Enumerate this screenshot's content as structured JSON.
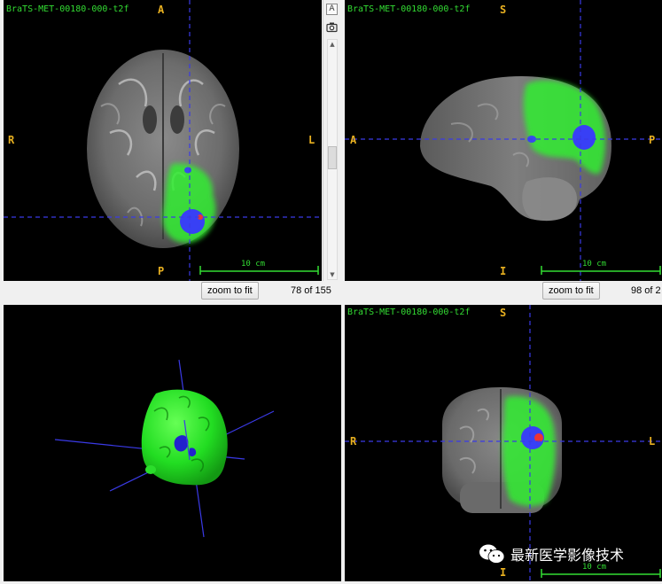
{
  "dataset": "BraTS-MET-00180-000-t2f",
  "scale_bar": "10 cm",
  "zoom_label": "zoom to fit",
  "axial": {
    "orientation": {
      "top": "A",
      "bottom": "P",
      "left": "R",
      "right": "L"
    },
    "slice_counter": "78 of 155"
  },
  "sagittal": {
    "orientation": {
      "top": "S",
      "bottom": "I",
      "left": "A",
      "right": "P"
    },
    "slice_counter": "98 of 2"
  },
  "coronal": {
    "orientation": {
      "top": "S",
      "bottom": "I",
      "left": "R",
      "right": "L"
    }
  },
  "toolbar": {
    "annotate_glyph": "A",
    "screenshot_glyph": "◘"
  },
  "watermark": {
    "text": "最新医学影像技术"
  },
  "colors": {
    "crosshair": "#3a3ae6",
    "segmentation_edema": "#33ee33",
    "segmentation_core": "#3838ff",
    "segmentation_enhancing": "#ee3333",
    "label_text": "#33dd33",
    "orientation_text": "#e8b020"
  },
  "icons": [
    "annotate-icon",
    "camera-icon",
    "wechat-icon",
    "scroll-up-arrow-icon",
    "scroll-down-arrow-icon"
  ]
}
